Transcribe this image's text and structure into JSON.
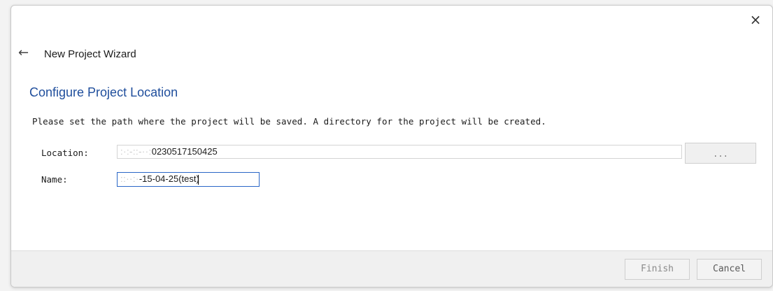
{
  "dialog": {
    "close_icon": "×",
    "back_icon": "←",
    "wizard_title": "New Project Wizard",
    "section_title": "Configure Project Location",
    "description": "Please set the path where the project will be saved. A directory for the project will be created."
  },
  "form": {
    "location_label": "Location:",
    "location_value_hidden": ":·:-::-··:",
    "location_value_visible": "0230517150425",
    "name_label": "Name:",
    "name_value_hidden": "::··:·",
    "name_value_visible": "-15-04-25(test)",
    "browse_label": "..."
  },
  "footer": {
    "finish_label": "Finish",
    "cancel_label": "Cancel"
  },
  "colors": {
    "accent": "#1f4e9c",
    "focus_border": "#2a66c7"
  }
}
